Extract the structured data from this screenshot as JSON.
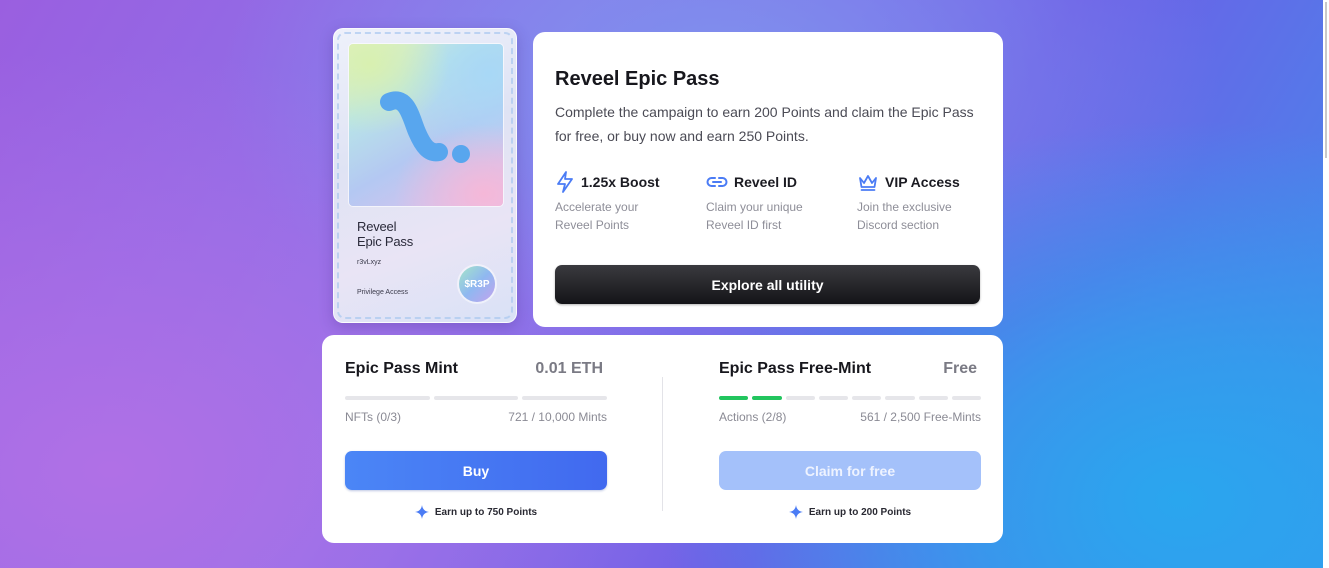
{
  "colors": {
    "accent_blue": "#4b7cf5",
    "success_green": "#22c55e",
    "dark_button": "#1a1a1e"
  },
  "nft_card": {
    "name_line1": "Reveel",
    "name_line2": "Epic Pass",
    "handle": "r3vLxyz",
    "access_label": "Privilege Access",
    "token_label": "$R3P",
    "logo_icon": "reveel-logo-icon"
  },
  "info": {
    "title": "Reveel Epic Pass",
    "description": "Complete the campaign to earn 200 Points and claim the Epic Pass for free, or buy now and earn 250 Points.",
    "features": [
      {
        "icon": "lightning-icon",
        "title": "1.25x Boost",
        "desc": "Accelerate your Reveel Points"
      },
      {
        "icon": "link-icon",
        "title": "Reveel ID",
        "desc": "Claim your unique Reveel ID first"
      },
      {
        "icon": "crown-icon",
        "title": "VIP Access",
        "desc": "Join the exclusive Discord section"
      }
    ],
    "explore_label": "Explore all utility"
  },
  "mint": {
    "title": "Epic Pass Mint",
    "price": "0.01 ETH",
    "progress_done": 0,
    "progress_total": 3,
    "stat_left": "NFTs (0/3)",
    "stat_right": "721 / 10,000 Mints",
    "button_label": "Buy",
    "earn_label": "Earn up to 750 Points"
  },
  "free_mint": {
    "title": "Epic Pass Free-Mint",
    "price": "Free",
    "progress_done": 2,
    "progress_total": 8,
    "stat_left": "Actions (2/8)",
    "stat_right": "561 / 2,500 Free-Mints",
    "button_label": "Claim for free",
    "earn_label": "Earn up to 200 Points"
  }
}
